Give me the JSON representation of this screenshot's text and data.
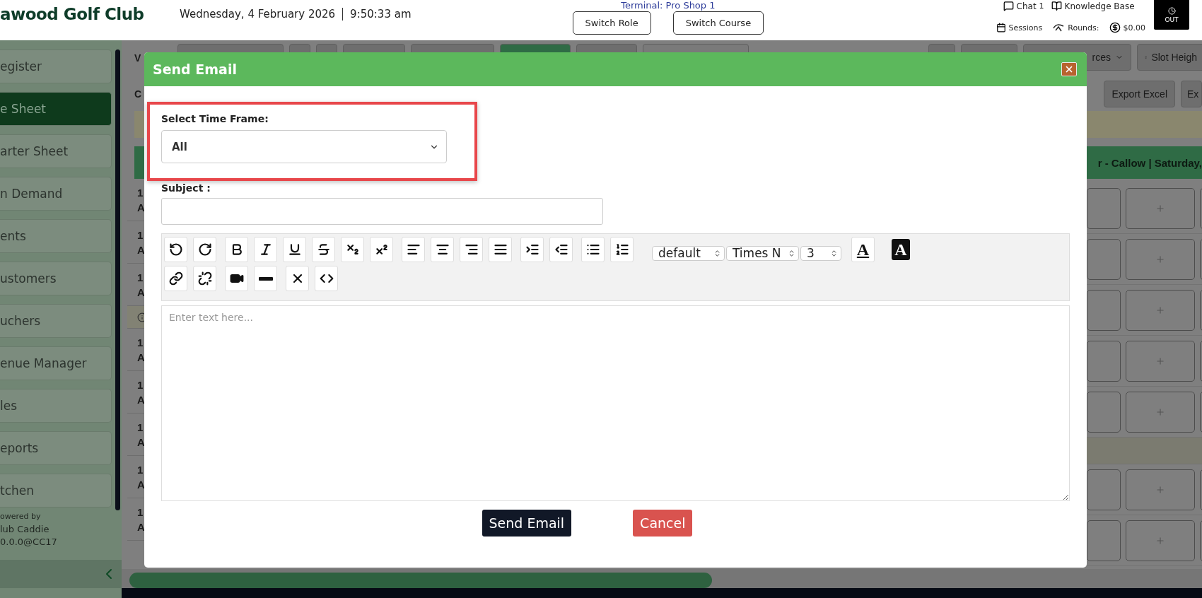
{
  "header": {
    "club_name": "awood Golf Club",
    "date": "Wednesday, 4 February 2026",
    "time": "9:50:33 am",
    "terminal": "Terminal: Pro Shop 1",
    "buttons": [
      "Switch Role",
      "Switch Course"
    ],
    "chat": "Chat",
    "chat_count": "1",
    "knowledge_base": "Knowledge Base",
    "sessions": "Sessions",
    "rounds": "Rounds:",
    "balance": "$0.00",
    "clock_out": "OUT"
  },
  "sidebar": {
    "items": [
      {
        "label": "egister",
        "selected": false
      },
      {
        "label": "e Sheet",
        "selected": true
      },
      {
        "label": "arter Sheet",
        "selected": false
      },
      {
        "label": "n Demand",
        "selected": false
      },
      {
        "label": "ents",
        "selected": false
      },
      {
        "label": "ustomers",
        "selected": false
      },
      {
        "label": "uchers",
        "selected": false
      },
      {
        "label": "enue Manager",
        "selected": false
      },
      {
        "label": "les",
        "selected": false
      },
      {
        "label": "eports",
        "selected": false
      },
      {
        "label": "tchen",
        "selected": false
      }
    ],
    "powered_by": [
      "owered by",
      "lub Caddie",
      "0.0.0@CC17"
    ]
  },
  "background": {
    "toolbar_letter": "V",
    "row_letter": "C",
    "resources_button": "rces",
    "slot_height_button": "Slot Heigh",
    "export_buttons": [
      "Export Excel",
      "Ex"
    ],
    "course_header": "r - Callow | Saturday,",
    "left_rows": [
      {
        "kind": "slot",
        "line_1": "1",
        "line_2": "A"
      },
      {
        "kind": "slot",
        "line_1": "1",
        "line_2": "A"
      },
      {
        "kind": "slot",
        "line_1": "1",
        "line_2": "A"
      },
      {
        "kind": "divider"
      },
      {
        "kind": "slot",
        "line_1": "1",
        "line_2": "A"
      },
      {
        "kind": "slot",
        "line_1": "1",
        "line_2": "A"
      },
      {
        "kind": "slot",
        "line_1": "1",
        "line_2": "A"
      },
      {
        "kind": "slot",
        "line_1": "1",
        "line_2": "A"
      },
      {
        "kind": "slot",
        "line_1": "1",
        "line_2": "A"
      }
    ],
    "right_rows": [
      {
        "kind": "slot"
      },
      {
        "kind": "slot"
      },
      {
        "kind": "slot"
      },
      {
        "kind": "slot"
      },
      {
        "kind": "slot"
      },
      {
        "kind": "divider"
      },
      {
        "kind": "slot"
      },
      {
        "kind": "slot"
      }
    ]
  },
  "modal": {
    "title": "Send Email",
    "time_frame_label": "Select Time Frame:",
    "time_frame_value": "All",
    "subject_label": "Subject :",
    "editor_selects": [
      "default",
      "Times N",
      "3"
    ],
    "font_color_label": "A",
    "highlight_color_label": "A",
    "editor_placeholder": "Enter text here...",
    "buttons": [
      {
        "kind": "primary",
        "label": "Send Email"
      },
      {
        "kind": "danger",
        "label": "Cancel"
      }
    ]
  }
}
